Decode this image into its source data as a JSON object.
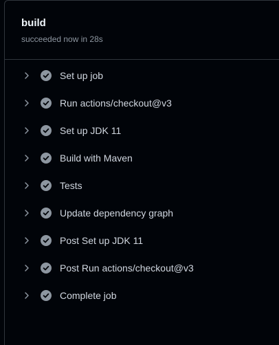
{
  "job": {
    "title": "build",
    "status": "succeeded now in 28s"
  },
  "steps": [
    {
      "label": "Set up job",
      "state": "success"
    },
    {
      "label": "Run actions/checkout@v3",
      "state": "success"
    },
    {
      "label": "Set up JDK 11",
      "state": "success"
    },
    {
      "label": "Build with Maven",
      "state": "success"
    },
    {
      "label": "Tests",
      "state": "success"
    },
    {
      "label": "Update dependency graph",
      "state": "success"
    },
    {
      "label": "Post Set up JDK 11",
      "state": "success"
    },
    {
      "label": "Post Run actions/checkout@v3",
      "state": "success"
    },
    {
      "label": "Complete job",
      "state": "success"
    }
  ],
  "icons": {
    "expand": "chevron-right-icon",
    "status": "check-circle-icon"
  },
  "colors": {
    "background": "#010409",
    "border": "#30363d",
    "icon": "#8d96a0",
    "text": "#d1d7e0",
    "title": "#f0f6fc"
  }
}
